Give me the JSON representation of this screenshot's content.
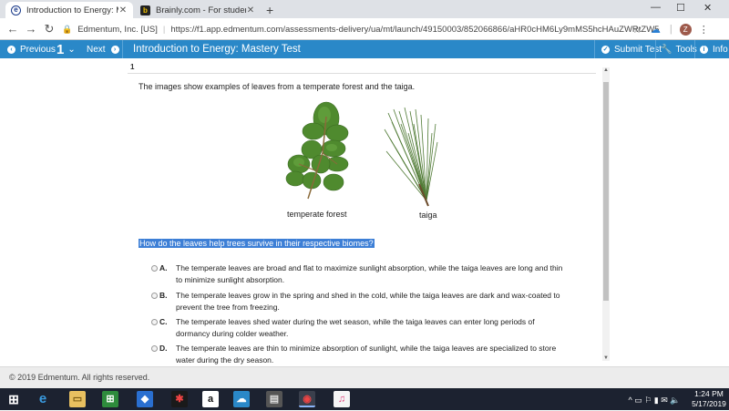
{
  "browser": {
    "tabs": [
      {
        "title": "Introduction to Energy: Mastery",
        "active": true
      },
      {
        "title": "Brainly.com - For students. By st",
        "active": false
      }
    ],
    "new_tab_glyph": "+",
    "window_controls": {
      "minimize": "—",
      "maximize": "☐",
      "close": "✕"
    },
    "site_name": "Edmentum, Inc. [US]",
    "url": "https://f1.app.edmentum.com/assessments-delivery/ua/mt/launch/49150003/852066866/aHR0cHM6Ly9mMS5hcHAuZWRtZW50dW0uY29tL2...",
    "profile_initial": "Z"
  },
  "appbar": {
    "previous_label": "Previous",
    "question_number": "1",
    "next_label": "Next",
    "title": "Introduction to Energy: Mastery Test",
    "submit_label": "Submit Test",
    "tools_label": "Tools",
    "info_label": "Info"
  },
  "question": {
    "number": "1",
    "prompt": "The images show examples of leaves from a temperate forest and the taiga.",
    "images": [
      {
        "caption": "temperate forest"
      },
      {
        "caption": "taiga"
      }
    ],
    "text": "How do the leaves help trees survive in their respective biomes?",
    "options": [
      {
        "letter": "A.",
        "text": "The temperate leaves are broad and flat to maximize sunlight absorption, while the taiga leaves are long and thin to minimize sunlight absorption."
      },
      {
        "letter": "B.",
        "text": "The temperate leaves grow in the spring and shed in the cold, while the taiga leaves are dark and wax-coated to prevent the tree from freezing."
      },
      {
        "letter": "C.",
        "text": "The temperate leaves shed water during the wet season, while the taiga leaves can enter long periods of dormancy during colder weather."
      },
      {
        "letter": "D.",
        "text": "The temperate leaves are thin to minimize absorption of sunlight, while the taiga leaves are specialized to store water during the dry season."
      }
    ]
  },
  "footer": {
    "copyright": "© 2019 Edmentum. All rights reserved."
  },
  "taskbar": {
    "time": "1:24 PM",
    "date": "5/17/2019"
  },
  "colors": {
    "appbar_blue": "#2a88c8",
    "highlight_blue": "#3d7fd6",
    "taskbar": "#1c2230"
  }
}
